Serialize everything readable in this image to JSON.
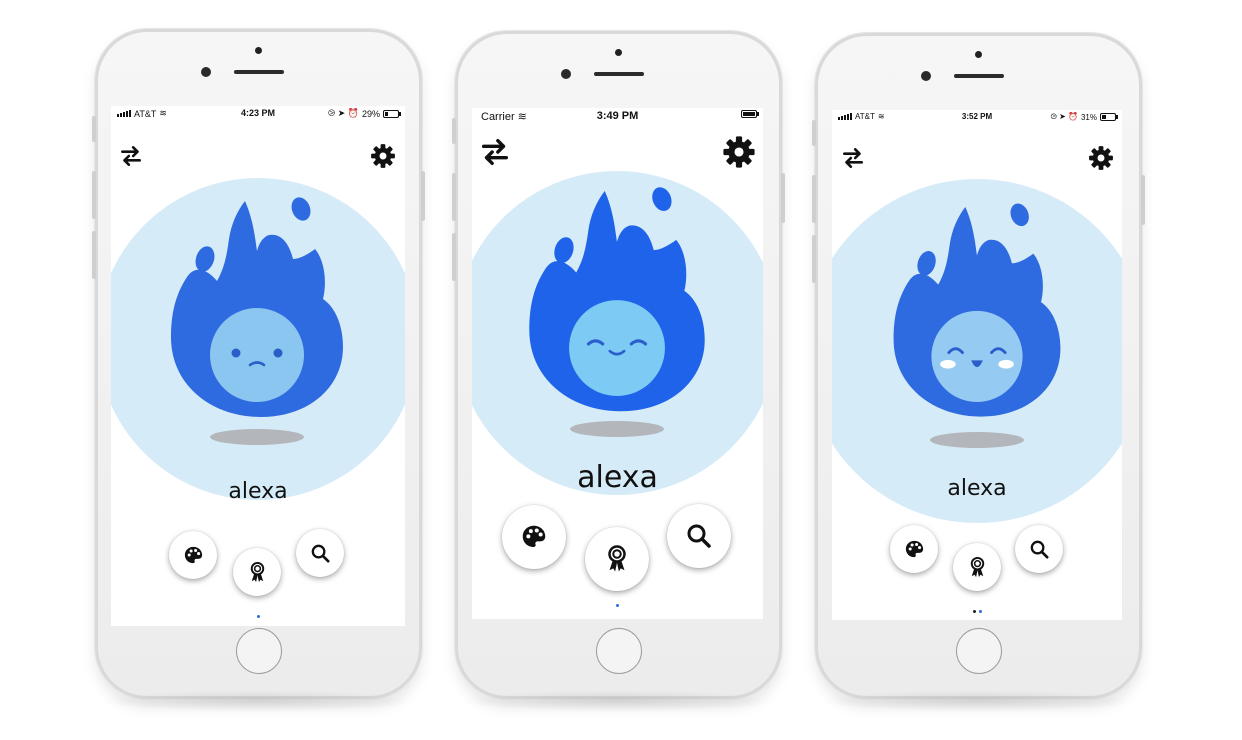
{
  "colors": {
    "flame": "#2f6be0",
    "flame_bright": "#1f63ea",
    "face": "#8ac6f0",
    "face_bright": "#7dcaf5",
    "face_pale": "#95cbf2",
    "bg_circle": "#d6ebf8",
    "shadow": "#b3b7bb",
    "eye": "#2b5ecb",
    "blush": "#ffffff",
    "dot_active": "#2f6be0",
    "dot_inactive": "#222222"
  },
  "screens": [
    {
      "id": "sad",
      "status": {
        "carrier": "AT&T",
        "time": "4:23 PM",
        "battery_text": "29%",
        "battery_level": 0.29,
        "right_icons": "⧁ ➤ ⏰"
      },
      "swap_icon": "swap-arrows-icon",
      "settings_icon": "gear-icon",
      "pet_name": "alexa",
      "mood": "sad",
      "actions": [
        "palette-icon",
        "award-ribbon-icon",
        "search-icon"
      ],
      "page_dots": {
        "count": 1,
        "active": 0
      }
    },
    {
      "id": "content",
      "status": {
        "carrier": "Carrier",
        "time": "3:49 PM",
        "battery_text": "",
        "battery_level": 1.0,
        "right_icons": ""
      },
      "swap_icon": "swap-arrows-icon",
      "settings_icon": "gear-icon",
      "pet_name": "alexa",
      "mood": "content",
      "actions": [
        "palette-icon",
        "award-ribbon-icon",
        "search-icon"
      ],
      "page_dots": {
        "count": 1,
        "active": 0
      }
    },
    {
      "id": "happy",
      "status": {
        "carrier": "AT&T",
        "time": "3:52 PM",
        "battery_text": "31%",
        "battery_level": 0.31,
        "right_icons": "⧁ ➤ ⏰"
      },
      "swap_icon": "swap-arrows-icon",
      "settings_icon": "gear-icon",
      "pet_name": "alexa",
      "mood": "happy",
      "actions": [
        "palette-icon",
        "award-ribbon-icon",
        "search-icon"
      ],
      "page_dots": {
        "count": 2,
        "active": 1
      }
    }
  ]
}
